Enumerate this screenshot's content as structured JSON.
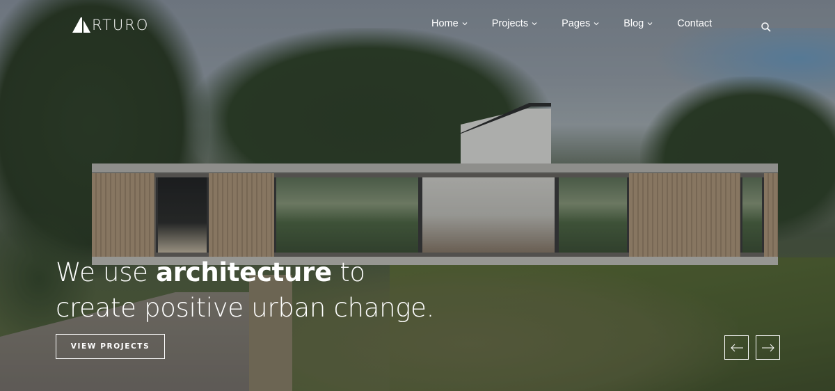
{
  "brand": {
    "name": "RTURO",
    "logo_icon": "a-logo-mark"
  },
  "nav": {
    "items": [
      {
        "label": "Home",
        "has_dropdown": true
      },
      {
        "label": "Projects",
        "has_dropdown": true
      },
      {
        "label": "Pages",
        "has_dropdown": true
      },
      {
        "label": "Blog",
        "has_dropdown": true
      },
      {
        "label": "Contact",
        "has_dropdown": false
      }
    ],
    "search_icon": "search-icon"
  },
  "hero": {
    "headline_pre": "We use ",
    "headline_bold": "architecture",
    "headline_post": " to",
    "headline_line2": "create positive urban change.",
    "cta_label": "VIEW PROJECTS",
    "prev_icon": "arrow-left-icon",
    "next_icon": "arrow-right-icon"
  },
  "colors": {
    "text": "#ffffff",
    "overlay": "#14181c"
  }
}
